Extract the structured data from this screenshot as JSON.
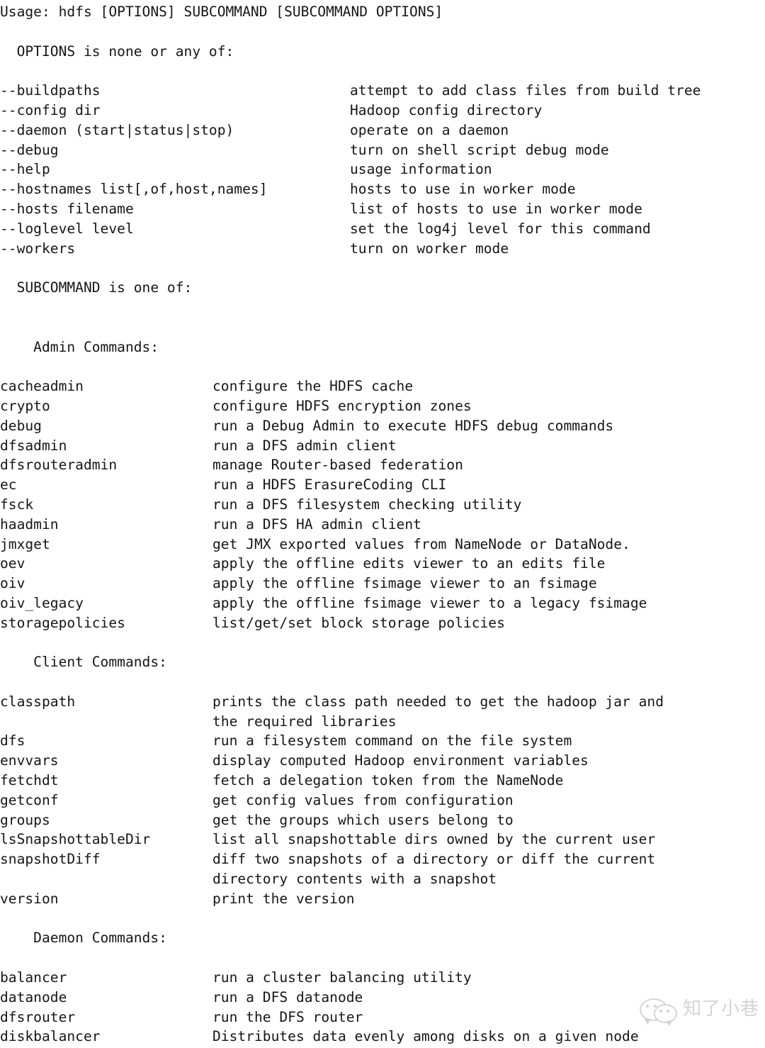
{
  "terminal": {
    "usage_line": "Usage: hdfs [OPTIONS] SUBCOMMAND [SUBCOMMAND OPTIONS]",
    "options_intro": "  OPTIONS is none or any of:",
    "subcommand_intro": "  SUBCOMMAND is one of:",
    "options": [
      {
        "name": "--buildpaths",
        "desc": "attempt to add class files from build tree"
      },
      {
        "name": "--config dir",
        "desc": "Hadoop config directory"
      },
      {
        "name": "--daemon (start|status|stop)",
        "desc": "operate on a daemon"
      },
      {
        "name": "--debug",
        "desc": "turn on shell script debug mode"
      },
      {
        "name": "--help",
        "desc": "usage information"
      },
      {
        "name": "--hostnames list[,of,host,names]",
        "desc": "hosts to use in worker mode"
      },
      {
        "name": "--hosts filename",
        "desc": "list of hosts to use in worker mode"
      },
      {
        "name": "--loglevel level",
        "desc": "set the log4j level for this command"
      },
      {
        "name": "--workers",
        "desc": "turn on worker mode"
      }
    ],
    "sections": [
      {
        "heading": "    Admin Commands:",
        "commands": [
          {
            "name": "cacheadmin",
            "desc": "configure the HDFS cache",
            "desc2": ""
          },
          {
            "name": "crypto",
            "desc": "configure HDFS encryption zones",
            "desc2": ""
          },
          {
            "name": "debug",
            "desc": "run a Debug Admin to execute HDFS debug commands",
            "desc2": ""
          },
          {
            "name": "dfsadmin",
            "desc": "run a DFS admin client",
            "desc2": ""
          },
          {
            "name": "dfsrouteradmin",
            "desc": "manage Router-based federation",
            "desc2": ""
          },
          {
            "name": "ec",
            "desc": "run a HDFS ErasureCoding CLI",
            "desc2": ""
          },
          {
            "name": "fsck",
            "desc": "run a DFS filesystem checking utility",
            "desc2": ""
          },
          {
            "name": "haadmin",
            "desc": "run a DFS HA admin client",
            "desc2": ""
          },
          {
            "name": "jmxget",
            "desc": "get JMX exported values from NameNode or DataNode.",
            "desc2": ""
          },
          {
            "name": "oev",
            "desc": "apply the offline edits viewer to an edits file",
            "desc2": ""
          },
          {
            "name": "oiv",
            "desc": "apply the offline fsimage viewer to an fsimage",
            "desc2": ""
          },
          {
            "name": "oiv_legacy",
            "desc": "apply the offline fsimage viewer to a legacy fsimage",
            "desc2": ""
          },
          {
            "name": "storagepolicies",
            "desc": "list/get/set block storage policies",
            "desc2": ""
          }
        ]
      },
      {
        "heading": "    Client Commands:",
        "commands": [
          {
            "name": "classpath",
            "desc": "prints the class path needed to get the hadoop jar and",
            "desc2": "the required libraries"
          },
          {
            "name": "dfs",
            "desc": "run a filesystem command on the file system",
            "desc2": ""
          },
          {
            "name": "envvars",
            "desc": "display computed Hadoop environment variables",
            "desc2": ""
          },
          {
            "name": "fetchdt",
            "desc": "fetch a delegation token from the NameNode",
            "desc2": ""
          },
          {
            "name": "getconf",
            "desc": "get config values from configuration",
            "desc2": ""
          },
          {
            "name": "groups",
            "desc": "get the groups which users belong to",
            "desc2": ""
          },
          {
            "name": "lsSnapshottableDir",
            "desc": "list all snapshottable dirs owned by the current user",
            "desc2": ""
          },
          {
            "name": "snapshotDiff",
            "desc": "diff two snapshots of a directory or diff the current",
            "desc2": "directory contents with a snapshot"
          },
          {
            "name": "version",
            "desc": "print the version",
            "desc2": ""
          }
        ]
      },
      {
        "heading": "    Daemon Commands:",
        "commands": [
          {
            "name": "balancer",
            "desc": "run a cluster balancing utility",
            "desc2": ""
          },
          {
            "name": "datanode",
            "desc": "run a DFS datanode",
            "desc2": ""
          },
          {
            "name": "dfsrouter",
            "desc": "run the DFS router",
            "desc2": ""
          },
          {
            "name": "diskbalancer",
            "desc": "Distributes data evenly among disks on a given node",
            "desc2": ""
          }
        ]
      }
    ]
  },
  "watermark": {
    "text": "知了小巷",
    "logo_icon": "wechat-bubbles-icon",
    "color": "#b7babf"
  }
}
